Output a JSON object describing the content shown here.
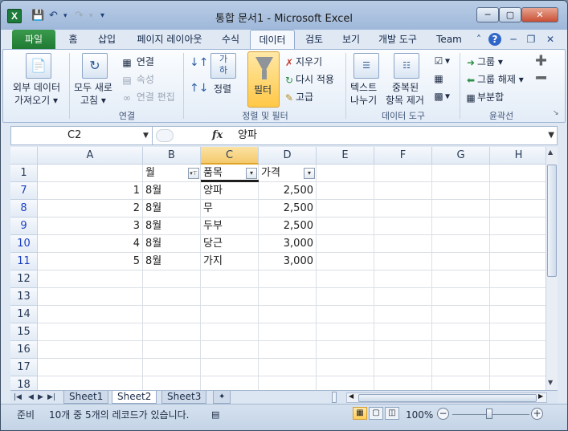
{
  "window": {
    "title": "통합 문서1  -  Microsoft Excel",
    "app_icon": "X",
    "controls": {
      "minimize": "─",
      "maximize": "▢",
      "close": "✕"
    }
  },
  "ribbon_tabs": {
    "file": "파일",
    "items": [
      "홈",
      "삽입",
      "페이지 레이아웃",
      "수식",
      "데이터",
      "검토",
      "보기",
      "개발 도구",
      "Team"
    ],
    "active": "데이터"
  },
  "ribbon": {
    "external_data": {
      "line1": "외부 데이터",
      "line2": "가져오기 ▾"
    },
    "connections": {
      "refresh_all_1": "모두 새로",
      "refresh_all_2": "고침 ▾",
      "connections": "연결",
      "properties": "속성",
      "edit_links": "연결 편집",
      "group_label": "연결"
    },
    "sort_filter": {
      "sort": "정렬",
      "filter": "필터",
      "clear": "지우기",
      "reapply": "다시 적용",
      "advanced": "고급",
      "group_label": "정렬 및 필터"
    },
    "data_tools": {
      "text_to_columns_1": "텍스트",
      "text_to_columns_2": "나누기",
      "remove_dup_1": "중복된",
      "remove_dup_2": "항목 제거",
      "group_label": "데이터 도구"
    },
    "outline": {
      "group": "그룹 ▾",
      "ungroup": "그룹 해제 ▾",
      "subtotal": "부분합",
      "group_label": "윤곽선"
    }
  },
  "formula_bar": {
    "name_box": "C2",
    "fx": "fx",
    "value": "양파"
  },
  "grid": {
    "columns": [
      "A",
      "B",
      "C",
      "D",
      "E",
      "F",
      "G",
      "H"
    ],
    "selected_column": "C",
    "rows": [
      {
        "num": "1",
        "cells": [
          "",
          "월",
          "품목",
          "가격",
          "",
          "",
          "",
          ""
        ],
        "header": true
      },
      {
        "num": "7",
        "cells": [
          "1",
          "8월",
          "양파",
          "2,500",
          "",
          "",
          "",
          ""
        ],
        "filtered": true
      },
      {
        "num": "8",
        "cells": [
          "2",
          "8월",
          "무",
          "2,500",
          "",
          "",
          "",
          ""
        ],
        "filtered": true
      },
      {
        "num": "9",
        "cells": [
          "3",
          "8월",
          "두부",
          "2,500",
          "",
          "",
          "",
          ""
        ],
        "filtered": true
      },
      {
        "num": "10",
        "cells": [
          "4",
          "8월",
          "당근",
          "3,000",
          "",
          "",
          "",
          ""
        ],
        "filtered": true
      },
      {
        "num": "11",
        "cells": [
          "5",
          "8월",
          "가지",
          "3,000",
          "",
          "",
          "",
          ""
        ],
        "filtered": true
      },
      {
        "num": "12",
        "cells": [
          "",
          "",
          "",
          "",
          "",
          "",
          "",
          ""
        ]
      },
      {
        "num": "13",
        "cells": [
          "",
          "",
          "",
          "",
          "",
          "",
          "",
          ""
        ]
      },
      {
        "num": "14",
        "cells": [
          "",
          "",
          "",
          "",
          "",
          "",
          "",
          ""
        ]
      },
      {
        "num": "15",
        "cells": [
          "",
          "",
          "",
          "",
          "",
          "",
          "",
          ""
        ]
      },
      {
        "num": "16",
        "cells": [
          "",
          "",
          "",
          "",
          "",
          "",
          "",
          ""
        ]
      },
      {
        "num": "17",
        "cells": [
          "",
          "",
          "",
          "",
          "",
          "",
          "",
          ""
        ]
      },
      {
        "num": "18",
        "cells": [
          "",
          "",
          "",
          "",
          "",
          "",
          "",
          ""
        ]
      }
    ]
  },
  "sheet_tabs": {
    "nav": [
      "|◀",
      "◀",
      "▶",
      "▶|"
    ],
    "tabs": [
      "Sheet1",
      "Sheet2",
      "Sheet3"
    ],
    "active": "Sheet2"
  },
  "status_bar": {
    "ready": "준비",
    "message": "10개 중 5개의 레코드가 있습니다.",
    "zoom": "100%"
  },
  "colors": {
    "file_tab": "#1f7a33",
    "filter_highlight": "#ffc847",
    "filtered_row_number": "#1a3fc4"
  }
}
